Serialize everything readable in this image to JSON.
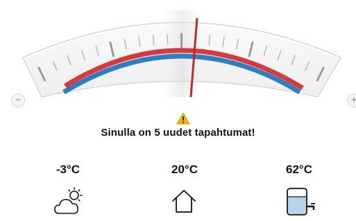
{
  "gauge": {
    "setpoint_icon_minus": "−",
    "setpoint_icon_plus": "+",
    "blue_color": "#2d7fc1",
    "red_color": "#d9393b",
    "needle_color": "#c0282a",
    "needle_position": 0.55
  },
  "notification": {
    "icon": "warning-icon",
    "text": "Sinulla on 5 uudet tapahtumat!"
  },
  "temperatures": {
    "outdoor": {
      "value": "-3°C",
      "icon": "weather-icon"
    },
    "indoor": {
      "value": "20°C",
      "icon": "house-icon"
    },
    "hot_water": {
      "value": "62°C",
      "icon": "water-tank-icon"
    }
  }
}
